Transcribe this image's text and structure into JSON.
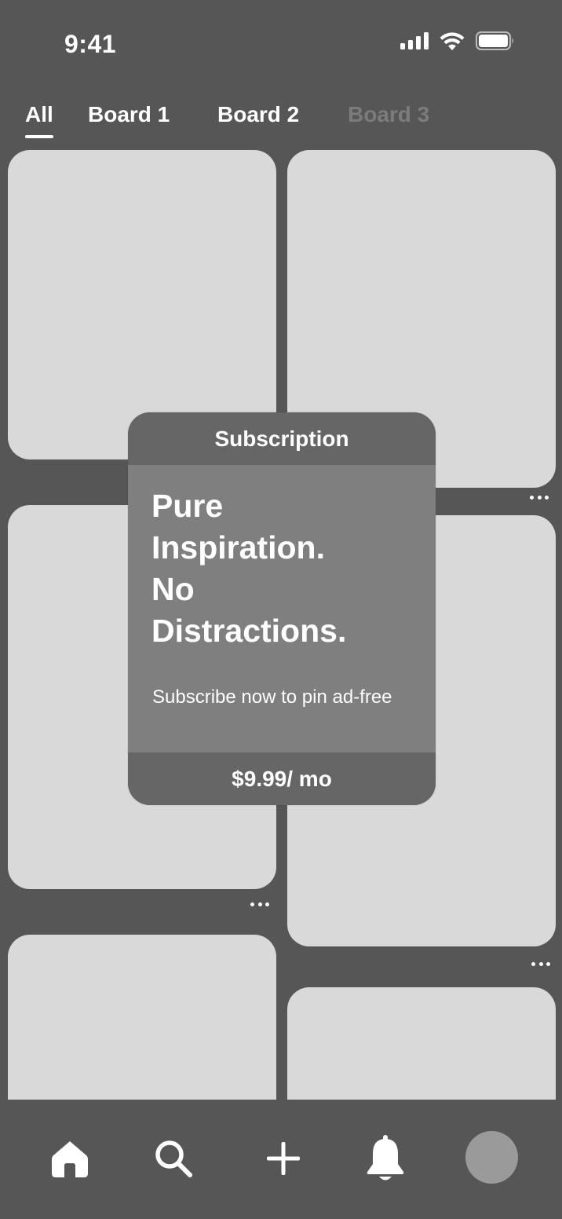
{
  "status_bar": {
    "time": "9:41",
    "icons": [
      "signal-icon",
      "wifi-icon",
      "battery-icon"
    ]
  },
  "tabs": [
    {
      "label": "All",
      "active": true
    },
    {
      "label": "Board 1",
      "active": false
    },
    {
      "label": "Board 2",
      "active": false
    },
    {
      "label": "Board 3",
      "active": false,
      "dimmed": true
    }
  ],
  "modal": {
    "title": "Subscription",
    "headline_lines": [
      "Pure",
      "Inspiration.",
      "No",
      "Distractions."
    ],
    "subtext": "Subscribe now to pin ad-free",
    "price": "$9.99/ mo"
  },
  "bottom_nav": {
    "items": [
      "home-icon",
      "search-icon",
      "plus-icon",
      "bell-icon",
      "avatar"
    ]
  },
  "colors": {
    "background": "#565656",
    "card": "#d9d9d9",
    "modal_header": "#666666",
    "modal_body": "#7f7f7f",
    "text": "#ffffff",
    "tab_dimmed": "#7c7c7c",
    "avatar": "#9a9a9a"
  }
}
